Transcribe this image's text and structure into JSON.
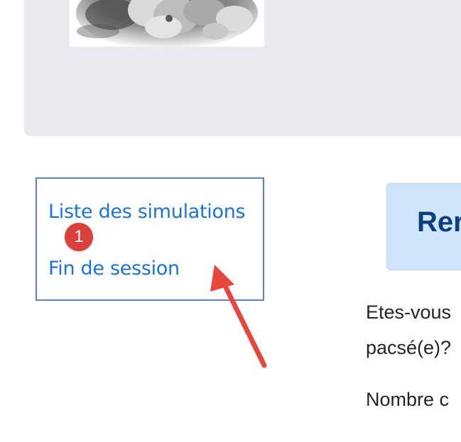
{
  "nav": {
    "links": [
      {
        "label": "Liste des simulations"
      },
      {
        "label": "Fin de session"
      }
    ]
  },
  "annotation": {
    "badge": "1",
    "badge_color": "#d9403c",
    "arrow_color": "#e8453c"
  },
  "main": {
    "title": "Rer",
    "question1_line1": "Etes-vous",
    "question1_line2": "pacsé(e)?",
    "question2": "Nombre c"
  },
  "colors": {
    "link": "#1a73d9",
    "nav_border": "#5b82c4",
    "banner_bg": "#e8eaef",
    "title_bg": "#cfe5fb",
    "title_text": "#0d3f7a"
  }
}
